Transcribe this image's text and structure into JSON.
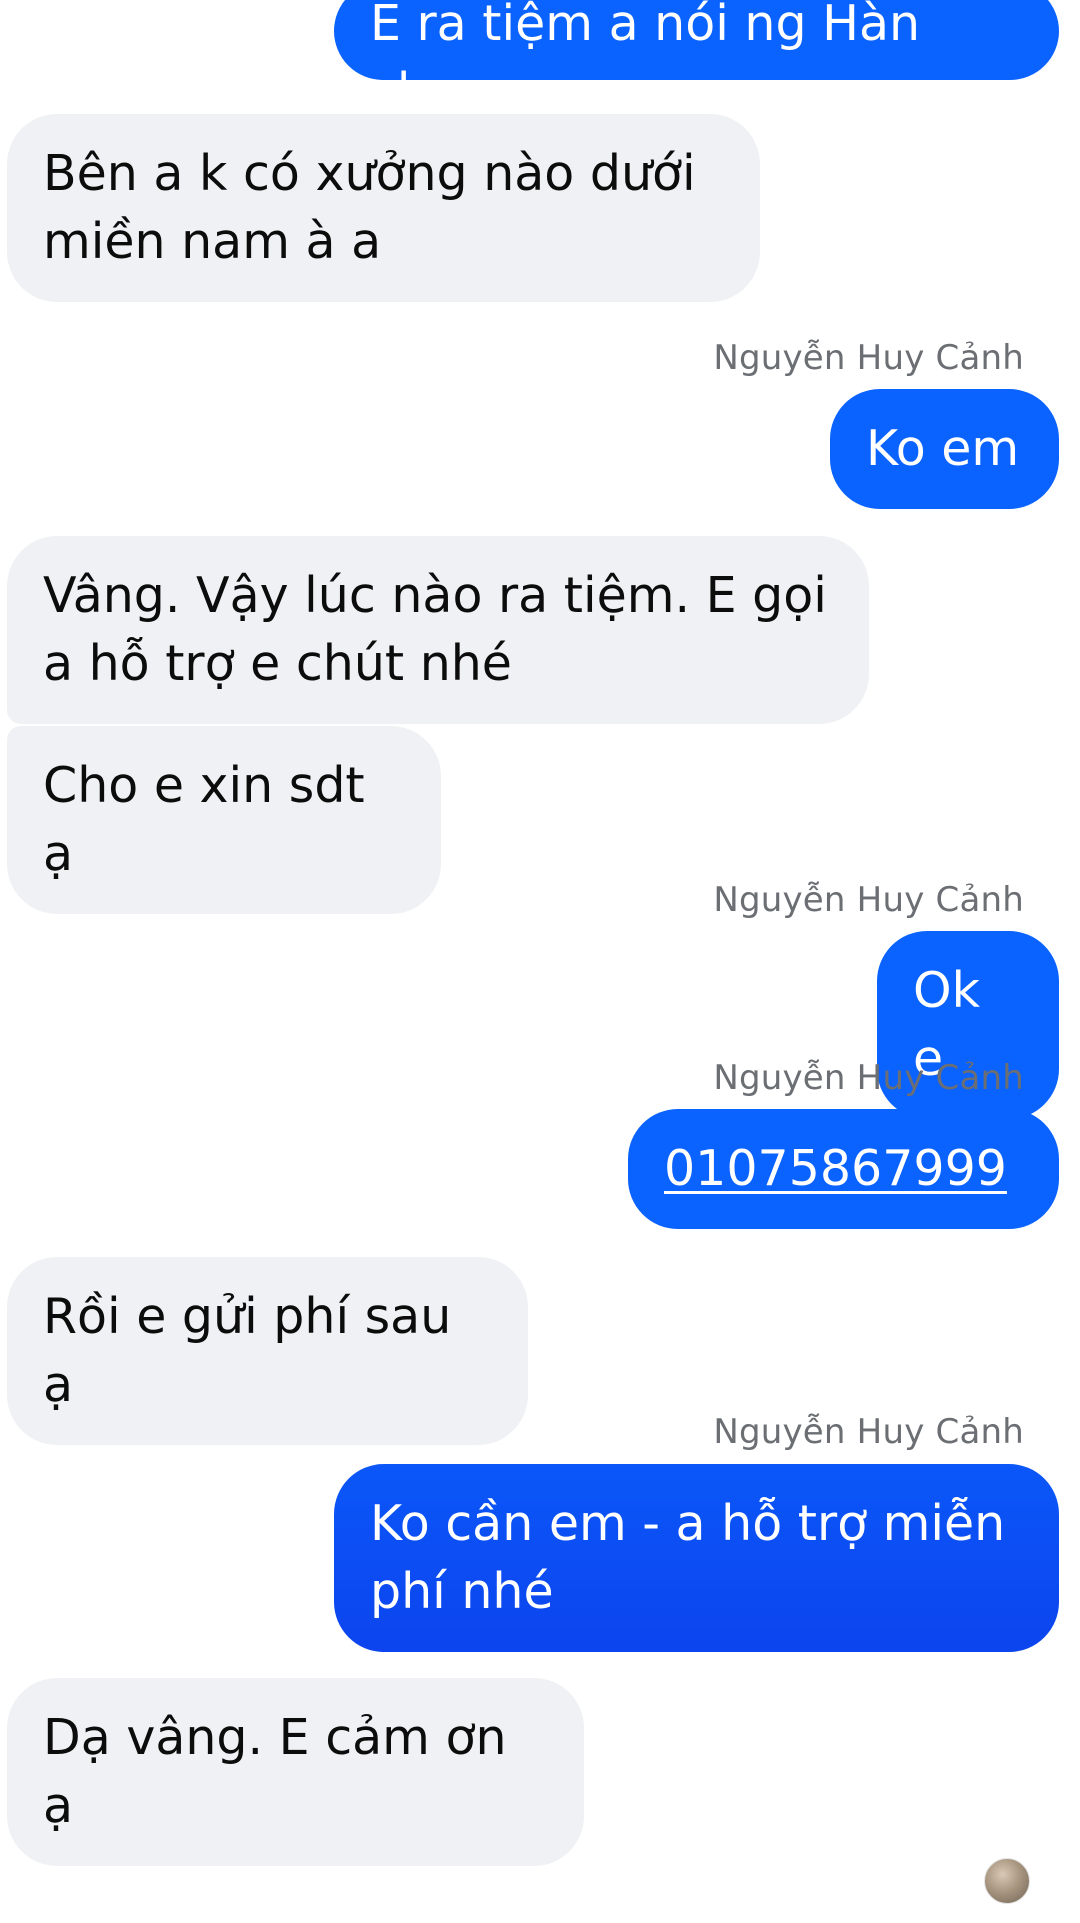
{
  "conversation": {
    "messages": [
      {
        "id": "m1",
        "direction": "outgoing",
        "text": "E ra tiệm a nói ng Hàn cho"
      },
      {
        "id": "m2",
        "direction": "incoming",
        "text": "Bên a k có xưởng nào dưới miền nam à a"
      },
      {
        "id": "m3",
        "direction": "outgoing",
        "sender": "Nguyễn Huy Cảnh",
        "text": "Ko em"
      },
      {
        "id": "m4",
        "direction": "incoming",
        "text": "Vâng. Vậy lúc nào ra tiệm. E gọi a hỗ trợ e chút nhé"
      },
      {
        "id": "m5",
        "direction": "incoming",
        "text": "Cho e xin sdt ạ"
      },
      {
        "id": "m6",
        "direction": "outgoing",
        "sender": "Nguyễn Huy Cảnh",
        "text": "Ok e"
      },
      {
        "id": "m7",
        "direction": "outgoing",
        "sender": "Nguyễn Huy Cảnh",
        "text": "01075867999"
      },
      {
        "id": "m8",
        "direction": "incoming",
        "text": "Rồi e gửi phí sau ạ"
      },
      {
        "id": "m9",
        "direction": "outgoing",
        "sender": "Nguyễn Huy Cảnh",
        "text": "Ko cần em - a hỗ trợ miễn phí nhé"
      },
      {
        "id": "m10",
        "direction": "incoming",
        "text": "Dạ vâng. E cảm ơn ạ"
      }
    ]
  },
  "colors": {
    "outgoing_bubble": "#0866ff",
    "incoming_bubble": "#f0f1f4",
    "sender_label": "#6b6e73"
  },
  "icons": {
    "seen_avatar": "avatar-icon"
  }
}
